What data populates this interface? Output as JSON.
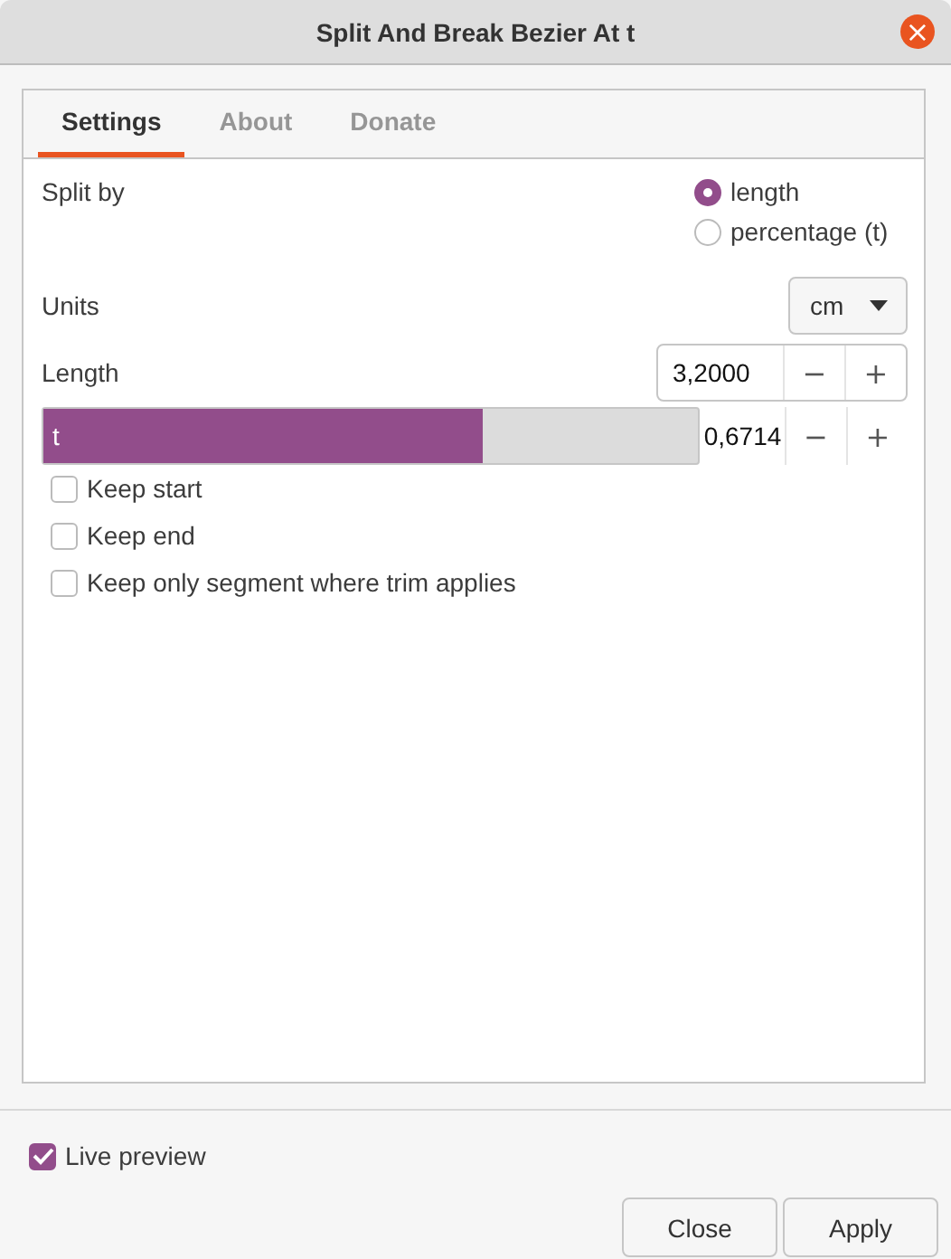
{
  "window": {
    "title": "Split And Break Bezier At t",
    "close": "×"
  },
  "tabs": [
    {
      "label": "Settings",
      "selected": true
    },
    {
      "label": "About",
      "selected": false
    },
    {
      "label": "Donate",
      "selected": false
    }
  ],
  "split_by": {
    "label": "Split by",
    "options": [
      {
        "label": "length",
        "selected": true
      },
      {
        "label": "percentage (t)",
        "selected": false
      }
    ]
  },
  "units": {
    "label": "Units",
    "value": "cm"
  },
  "length": {
    "label": "Length",
    "value": "3,2000",
    "decrement": "−",
    "increment": "+"
  },
  "t_slider": {
    "label": "t",
    "level": 0.6714,
    "value": "0,6714",
    "decrement": "−",
    "increment": "+"
  },
  "options": [
    {
      "label": "Keep start",
      "checked": false
    },
    {
      "label": "Keep end",
      "checked": false
    },
    {
      "label": "Keep only segment where trim applies",
      "checked": false
    }
  ],
  "live_preview": {
    "label": "Live preview",
    "checked": true
  },
  "buttons": [
    "Close",
    "Apply"
  ]
}
